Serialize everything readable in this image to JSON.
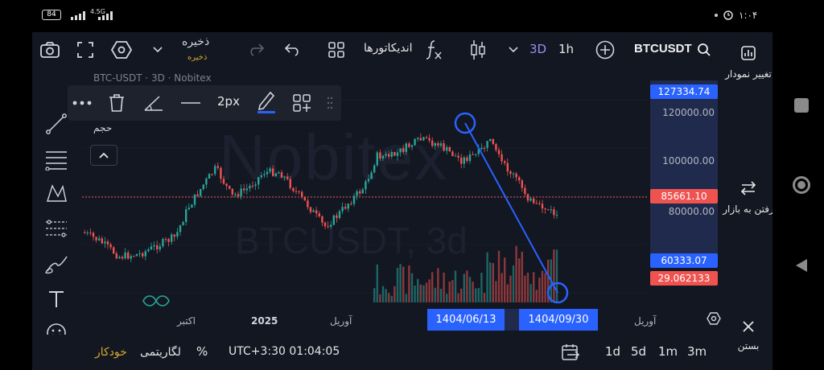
{
  "status_bar": {
    "battery": "84",
    "network": "4.5G",
    "clock": "۱:۰۴"
  },
  "toolbar": {
    "save_label": "ذخیره",
    "save_sublabel": "ذخیره",
    "indicators_label": "اندیکاتورها",
    "timeframe_active": "3D",
    "timeframe_other": "1h",
    "symbol": "BTCUSDT"
  },
  "side_panel": {
    "change_chart": "تغییر نمودار",
    "go_to_market": "رفتن به بازار",
    "close": "بستن"
  },
  "chart": {
    "legend": "BTC-USDT · 3D · Nobitex",
    "volume_label": "حجم",
    "watermark_brand": "Nobitex",
    "watermark_symbol": "BTCUSDT, 3d",
    "line_width_label": "2px"
  },
  "price_axis": {
    "ticks": [
      "120000.00",
      "100000.00",
      "80000.00"
    ],
    "top_marker": "127334.74",
    "current_price": "85661.10",
    "bottom_marker": "60333.07",
    "volume_value": "29.062133"
  },
  "time_axis": {
    "ticks": [
      "اکتبر",
      "2025",
      "آوریل",
      "آوریل"
    ],
    "start_marker": "1404/06/13",
    "end_marker": "1404/09/30"
  },
  "bottom_bar": {
    "auto_label": "خودکار",
    "log_label": "لگاریتمی",
    "percent_label": "%",
    "timezone": "UTC+3:30 01:04:05",
    "ranges": [
      "1d",
      "5d",
      "1m",
      "3m"
    ]
  },
  "colors": {
    "background": "#131722",
    "up": "#26a69a",
    "down": "#ef5350",
    "accent": "#2962ff",
    "active_timeframe": "#9b8cf2",
    "auto_gold": "#d4a72c"
  }
}
